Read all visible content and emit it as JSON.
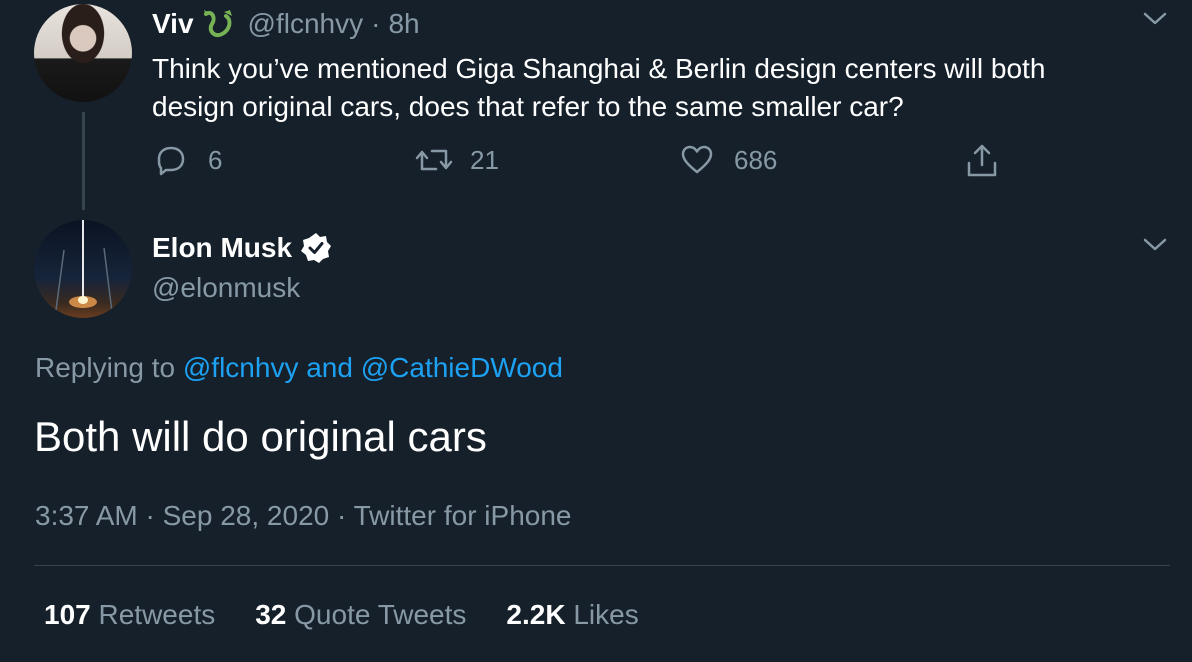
{
  "reply_parent": {
    "name": "Viv",
    "handle": "@flcnhvy",
    "separator": "·",
    "time": "8h",
    "text_line1": "Think you’ve mentioned Giga Shanghai & Berlin design centers will both",
    "text_line2": "design original cars, does that refer to the same smaller car?",
    "actions": {
      "replies": "6",
      "retweets": "21",
      "likes": "686"
    }
  },
  "main_tweet": {
    "name": "Elon Musk",
    "handle": "@elonmusk",
    "replying_prefix": "Replying to",
    "reply_to_1": "@flcnhvy",
    "reply_to_and": "and",
    "reply_to_2": "@CathieDWood",
    "text": "Both will do original cars",
    "time": "3:37 AM",
    "dot": "·",
    "date": "Sep 28, 2020",
    "dot2": "·",
    "source": "Twitter for iPhone"
  },
  "stats": {
    "retweets_count": "107",
    "retweets_label": "Retweets",
    "quotes_count": "32",
    "quotes_label": "Quote Tweets",
    "likes_count": "2.2K",
    "likes_label": "Likes"
  },
  "colors": {
    "background": "#15202b",
    "muted": "#8899a6",
    "link": "#1da1f2",
    "emoji_green": "#77b255"
  }
}
